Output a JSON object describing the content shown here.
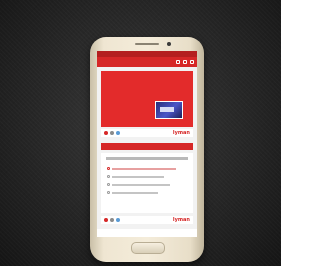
{
  "scene": {
    "background_color": "#262626",
    "phone_color": "#efe6d2",
    "accent_color": "#d62727"
  },
  "phone": {
    "status_text": "",
    "card1": {
      "title": "",
      "image_icon": "promo-image-icon"
    },
    "brand_text": "lyman",
    "section_label": "",
    "icons": [
      "toolbar-icon",
      "share-icon",
      "menu-icon"
    ]
  }
}
